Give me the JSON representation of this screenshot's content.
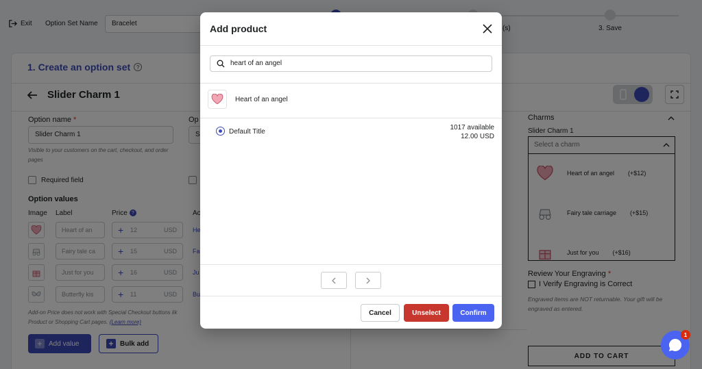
{
  "topbar": {
    "exit_label": "Exit",
    "option_set_name_label": "Option Set Name",
    "option_set_name_value": "Bracelet",
    "steps": [
      {
        "label": "",
        "state": "active"
      },
      {
        "label": "(s)",
        "state": "pending"
      },
      {
        "label": "3. Save",
        "state": "pending"
      }
    ]
  },
  "card": {
    "title": "1. Create an option set",
    "option_title": "Slider Charm 1",
    "option_name_label": "Option name",
    "option_name_value": "Slider Charm 1",
    "option_name_hint": "Visible to your customers on the cart, checkout, and order pages",
    "second_col_label": "Op",
    "second_col_value": "S",
    "required_field_label": "Required field",
    "option_values_label": "Option values",
    "columns": {
      "image": "Image",
      "label": "Label",
      "price": "Price",
      "action": "Ac"
    },
    "rows": [
      {
        "label": "Heart of an",
        "price": "12",
        "currency": "USD",
        "action": "He",
        "icon": "heart-charm-icon"
      },
      {
        "label": "Fairy tale ca",
        "price": "15",
        "currency": "USD",
        "action": "Fa",
        "icon": "carriage-charm-icon"
      },
      {
        "label": "Just for you",
        "price": "16",
        "currency": "USD",
        "action": "Ju",
        "icon": "gift-charm-icon"
      },
      {
        "label": "Butterfly kis",
        "price": "11",
        "currency": "USD",
        "action": "Bu",
        "icon": "butterfly-charm-icon"
      }
    ],
    "addon_note": "Add-on Price does not work with Special Checkout buttons lik",
    "addon_note_2": "Product or Shopping Cart pages.",
    "learn_more": "(Learn more)",
    "add_value_label": "Add value",
    "bulk_add_label": "Bulk add"
  },
  "preview": {
    "heading": "Charms",
    "sub_label": "Slider Charm 1",
    "select_placeholder": "Select a charm",
    "items": [
      {
        "name": "Heart of an angel",
        "price": "(+$12)",
        "icon": "heart-charm-icon"
      },
      {
        "name": "Fairy tale carriage",
        "price": "(+$15)",
        "icon": "carriage-charm-icon"
      },
      {
        "name": "Just for you",
        "price": "(+$16)",
        "icon": "gift-charm-icon"
      }
    ],
    "review_heading": "Review Your Engraving",
    "verify_label": "I Verify Engraving is Correct",
    "engraving_note": "Engraved items are NOT returnable. Your gift will be engraved as entered.",
    "add_to_cart": "ADD TO CART"
  },
  "modal": {
    "title": "Add product",
    "search_value": "heart of an angel",
    "product_name": "Heart of an angel",
    "variant_name": "Default Title",
    "variant_available": "1017 available",
    "variant_price": "12.00 USD",
    "cancel_label": "Cancel",
    "unselect_label": "Unselect",
    "confirm_label": "Confirm"
  },
  "chat": {
    "badge_count": "1"
  },
  "colors": {
    "accent": "#3c4bb8",
    "danger": "#c8372d",
    "confirm": "#4a63f0"
  }
}
